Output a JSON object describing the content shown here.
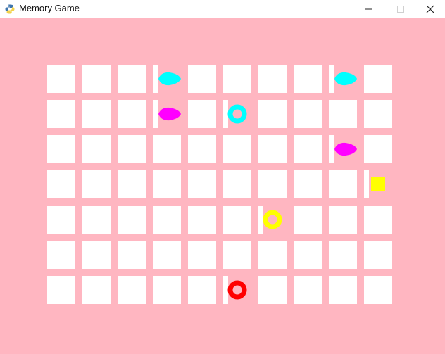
{
  "window": {
    "title": "Memory Game",
    "icon": "python-icon",
    "controls": [
      {
        "name": "minimize-button",
        "icon": "minimize-icon"
      },
      {
        "name": "maximize-button",
        "icon": "maximize-icon"
      },
      {
        "name": "close-button",
        "icon": "close-icon"
      }
    ]
  },
  "game": {
    "background_color": "#ffb6c1",
    "card_color": "#ffffff",
    "grid": {
      "rows": 7,
      "columns": 10
    },
    "revealed_cards": [
      {
        "row": 0,
        "col": 3,
        "shape": "oval",
        "color": "#00ffff"
      },
      {
        "row": 0,
        "col": 8,
        "shape": "oval",
        "color": "#00ffff"
      },
      {
        "row": 1,
        "col": 3,
        "shape": "oval",
        "color": "#ff00ff"
      },
      {
        "row": 1,
        "col": 5,
        "shape": "donut",
        "color": "#00ffff"
      },
      {
        "row": 2,
        "col": 8,
        "shape": "oval",
        "color": "#ff00ff"
      },
      {
        "row": 3,
        "col": 9,
        "shape": "square",
        "color": "#ffff00"
      },
      {
        "row": 4,
        "col": 6,
        "shape": "donut",
        "color": "#ffff00"
      },
      {
        "row": 6,
        "col": 5,
        "shape": "donut",
        "color": "#ff0000"
      }
    ]
  }
}
